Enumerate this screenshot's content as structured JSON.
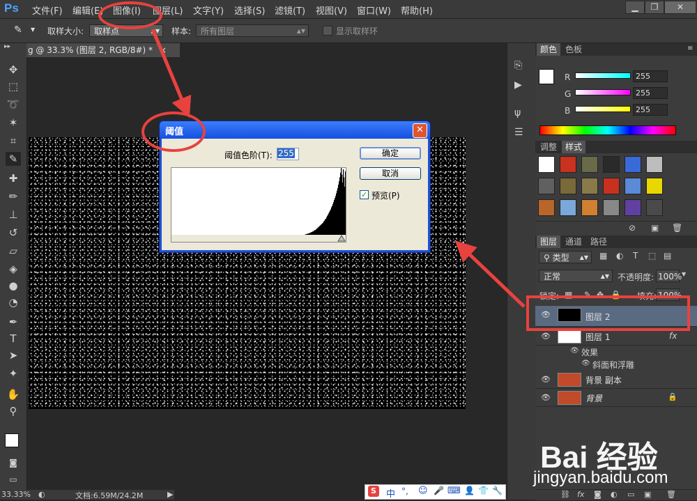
{
  "app": {
    "logo": "Ps"
  },
  "menu": {
    "items": [
      "文件(F)",
      "编辑(E)",
      "图像(I)",
      "图层(L)",
      "文字(Y)",
      "选择(S)",
      "滤镜(T)",
      "视图(V)",
      "窗口(W)",
      "帮助(H)"
    ]
  },
  "window_controls": {
    "minimize": "▁",
    "restore": "❐",
    "close": "✕"
  },
  "options_bar": {
    "sample_size_label": "取样大小:",
    "sample_size_value": "取样点",
    "sample_label": "样本:",
    "sample_value": "所有图层",
    "show_ring_label": "显示取样环"
  },
  "document": {
    "tab_title": "g @ 33.3% (图层 2, RGB/8#) *",
    "tab_close": "×"
  },
  "status_bar": {
    "zoom": "33.33%",
    "doc_info": "文档:6.59M/24.2M"
  },
  "dialog": {
    "title": "阈值",
    "level_label": "阈值色阶(T):",
    "level_value": "255",
    "ok": "确定",
    "cancel": "取消",
    "preview_label": "预览(P)",
    "preview_checked": true,
    "histogram": [
      0,
      0,
      0,
      0,
      0,
      0,
      0,
      0,
      0,
      0,
      0,
      0,
      0,
      0,
      0,
      0,
      0,
      0,
      0,
      0,
      0,
      0,
      0,
      0,
      0,
      0,
      0,
      0,
      0,
      0,
      0,
      0,
      0,
      0,
      0,
      0,
      0,
      0,
      0,
      0,
      0,
      0,
      0,
      0,
      0,
      0,
      0,
      0,
      0,
      0,
      0,
      0,
      0,
      0,
      0,
      0,
      0,
      0,
      0,
      0,
      0,
      0,
      0,
      0,
      0,
      0,
      0,
      0,
      0,
      0,
      0,
      0,
      0,
      0,
      0,
      0,
      0,
      0,
      0,
      0,
      0,
      0,
      0,
      0,
      0,
      0,
      0,
      0,
      0,
      0,
      0,
      0,
      0,
      0,
      0,
      0,
      0,
      0,
      0,
      0,
      0,
      0,
      0,
      0,
      0,
      0,
      0,
      0,
      0,
      0,
      0,
      0,
      0,
      0,
      0,
      0,
      0,
      0,
      0,
      0,
      0,
      0,
      0,
      0,
      0,
      0,
      0,
      0,
      0,
      0,
      0,
      0,
      0,
      0,
      0,
      0,
      0,
      0,
      0,
      0,
      0,
      0,
      0,
      0,
      0,
      0,
      0,
      0,
      0,
      0,
      0,
      0,
      0,
      0,
      0,
      0,
      0,
      0,
      0,
      0,
      0,
      0,
      0,
      0,
      0,
      0,
      0,
      0,
      0,
      0,
      0,
      0,
      0,
      0,
      0,
      0,
      0,
      0,
      0,
      0,
      0,
      0,
      0,
      0,
      0,
      0,
      0,
      0,
      0,
      0,
      0,
      1,
      1,
      1,
      2,
      2,
      2,
      3,
      3,
      4,
      4,
      5,
      5,
      6,
      7,
      7,
      8,
      9,
      10,
      11,
      12,
      13,
      14,
      15,
      16,
      17,
      18,
      20,
      21,
      23,
      24,
      26,
      28,
      30,
      32,
      34,
      36,
      38,
      41,
      43,
      46,
      49,
      52,
      55,
      58,
      62,
      66,
      70,
      75,
      80,
      86,
      93,
      100,
      90,
      78,
      98,
      86,
      72,
      95
    ],
    "threshold_marker_level": 255
  },
  "color_panel": {
    "tabs": [
      "颜色",
      "色板"
    ],
    "channels": [
      {
        "label": "R",
        "value": "255",
        "gradient": "#00ffff"
      },
      {
        "label": "G",
        "value": "255",
        "gradient": "#ff00ff"
      },
      {
        "label": "B",
        "value": "255",
        "gradient": "#ffff00"
      }
    ]
  },
  "styles_panel": {
    "tabs": [
      "调整",
      "样式"
    ],
    "swatches": [
      "#ffffff",
      "#c8321e",
      "#6a6a4a",
      "#2a2a2a",
      "#3a6ad8",
      "#bdbdbd",
      "#606060",
      "#7a6a3a",
      "#8a7a4a",
      "#c83020",
      "#5a8ad8",
      "#e8d800",
      "#b8662a",
      "#7aa8d8",
      "#d08030",
      "#888888",
      "#6040a0",
      "#4a4a4a"
    ]
  },
  "layers_panel": {
    "tabs": [
      "图层",
      "通道",
      "路径"
    ],
    "filter_label": "类型",
    "blend_mode": "正常",
    "opacity_label": "不透明度:",
    "opacity_value": "100%",
    "lock_label": "锁定:",
    "fill_label": "填充:",
    "fill_value": "100%",
    "layers": [
      {
        "name": "图层 2",
        "thumb": "#000000"
      },
      {
        "name": "图层 1",
        "thumb": "#ffffff",
        "fx": "fx"
      },
      {
        "name": "背景 副本",
        "thumb": "#c04a2a"
      },
      {
        "name": "背景",
        "thumb": "#c04a2a",
        "locked": true
      }
    ],
    "effects_label": "效果",
    "effect_item": "斜面和浮雕"
  },
  "watermark": {
    "logo": "Bai  经验",
    "url": "jingyan.baidu.com"
  },
  "ime": {
    "items": [
      "S",
      "中",
      "°,",
      "☺",
      "🎤",
      "⌨",
      "👤",
      "👕",
      "🔧"
    ]
  }
}
